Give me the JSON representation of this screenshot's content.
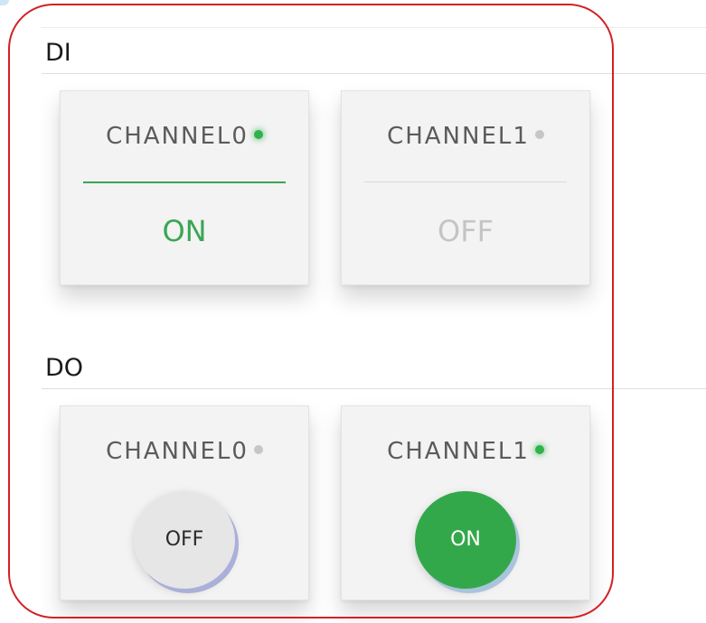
{
  "di": {
    "title": "DI",
    "channels": [
      {
        "label": "CHANNEL0",
        "indicator": "on",
        "status": "ON"
      },
      {
        "label": "CHANNEL1",
        "indicator": "off",
        "status": "OFF"
      }
    ]
  },
  "do": {
    "title": "DO",
    "channels": [
      {
        "label": "CHANNEL0",
        "indicator": "off",
        "button_label": "OFF"
      },
      {
        "label": "CHANNEL1",
        "indicator": "on",
        "button_label": "ON"
      }
    ]
  },
  "colors": {
    "on_green": "#3aa655",
    "off_grey": "#c4c4c4",
    "highlight_red": "#d32026",
    "card_bg": "#f3f3f3"
  }
}
